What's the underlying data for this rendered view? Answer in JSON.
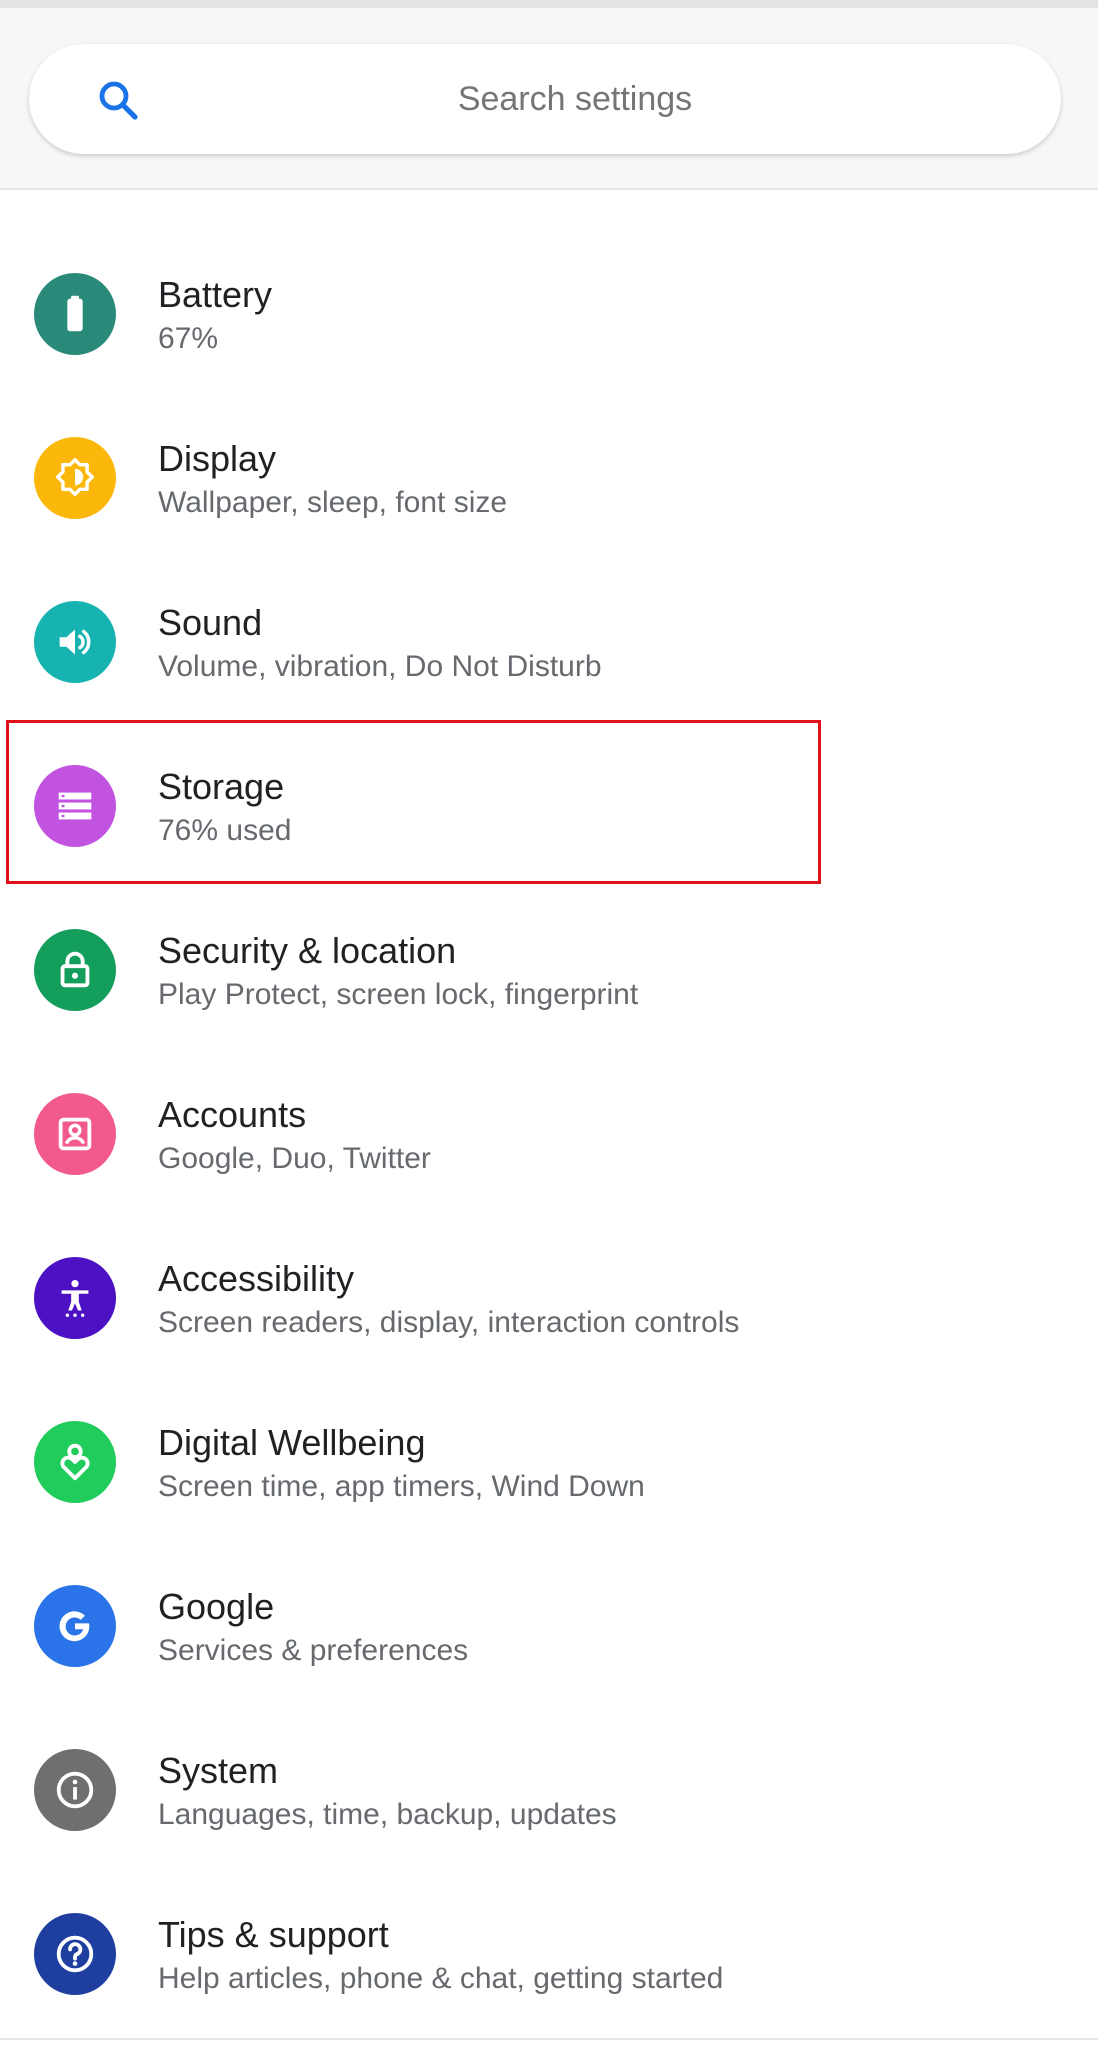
{
  "search": {
    "placeholder": "Search settings"
  },
  "items": [
    {
      "title": "Battery",
      "subtitle": "67%",
      "icon": "battery-icon",
      "color": "#2a8a7a"
    },
    {
      "title": "Display",
      "subtitle": "Wallpaper, sleep, font size",
      "icon": "brightness-icon",
      "color": "#fbb80a"
    },
    {
      "title": "Sound",
      "subtitle": "Volume, vibration, Do Not Disturb",
      "icon": "volume-icon",
      "color": "#17b3b0"
    },
    {
      "title": "Storage",
      "subtitle": "76% used",
      "icon": "storage-icon",
      "color": "#c153e0"
    },
    {
      "title": "Security & location",
      "subtitle": "Play Protect, screen lock, fingerprint",
      "icon": "lock-icon",
      "color": "#149e5c"
    },
    {
      "title": "Accounts",
      "subtitle": "Google, Duo, Twitter",
      "icon": "account-icon",
      "color": "#f15a8b"
    },
    {
      "title": "Accessibility",
      "subtitle": "Screen readers, display, interaction controls",
      "icon": "accessibility-icon",
      "color": "#4c11c2"
    },
    {
      "title": "Digital Wellbeing",
      "subtitle": "Screen time, app timers, Wind Down",
      "icon": "wellbeing-icon",
      "color": "#1fcc5c"
    },
    {
      "title": "Google",
      "subtitle": "Services & preferences",
      "icon": "google-icon",
      "color": "#2a73e8"
    },
    {
      "title": "System",
      "subtitle": "Languages, time, backup, updates",
      "icon": "info-icon",
      "color": "#6f6f6f"
    },
    {
      "title": "Tips & support",
      "subtitle": "Help articles, phone & chat, getting started",
      "icon": "help-icon",
      "color": "#1e3fa0"
    }
  ]
}
